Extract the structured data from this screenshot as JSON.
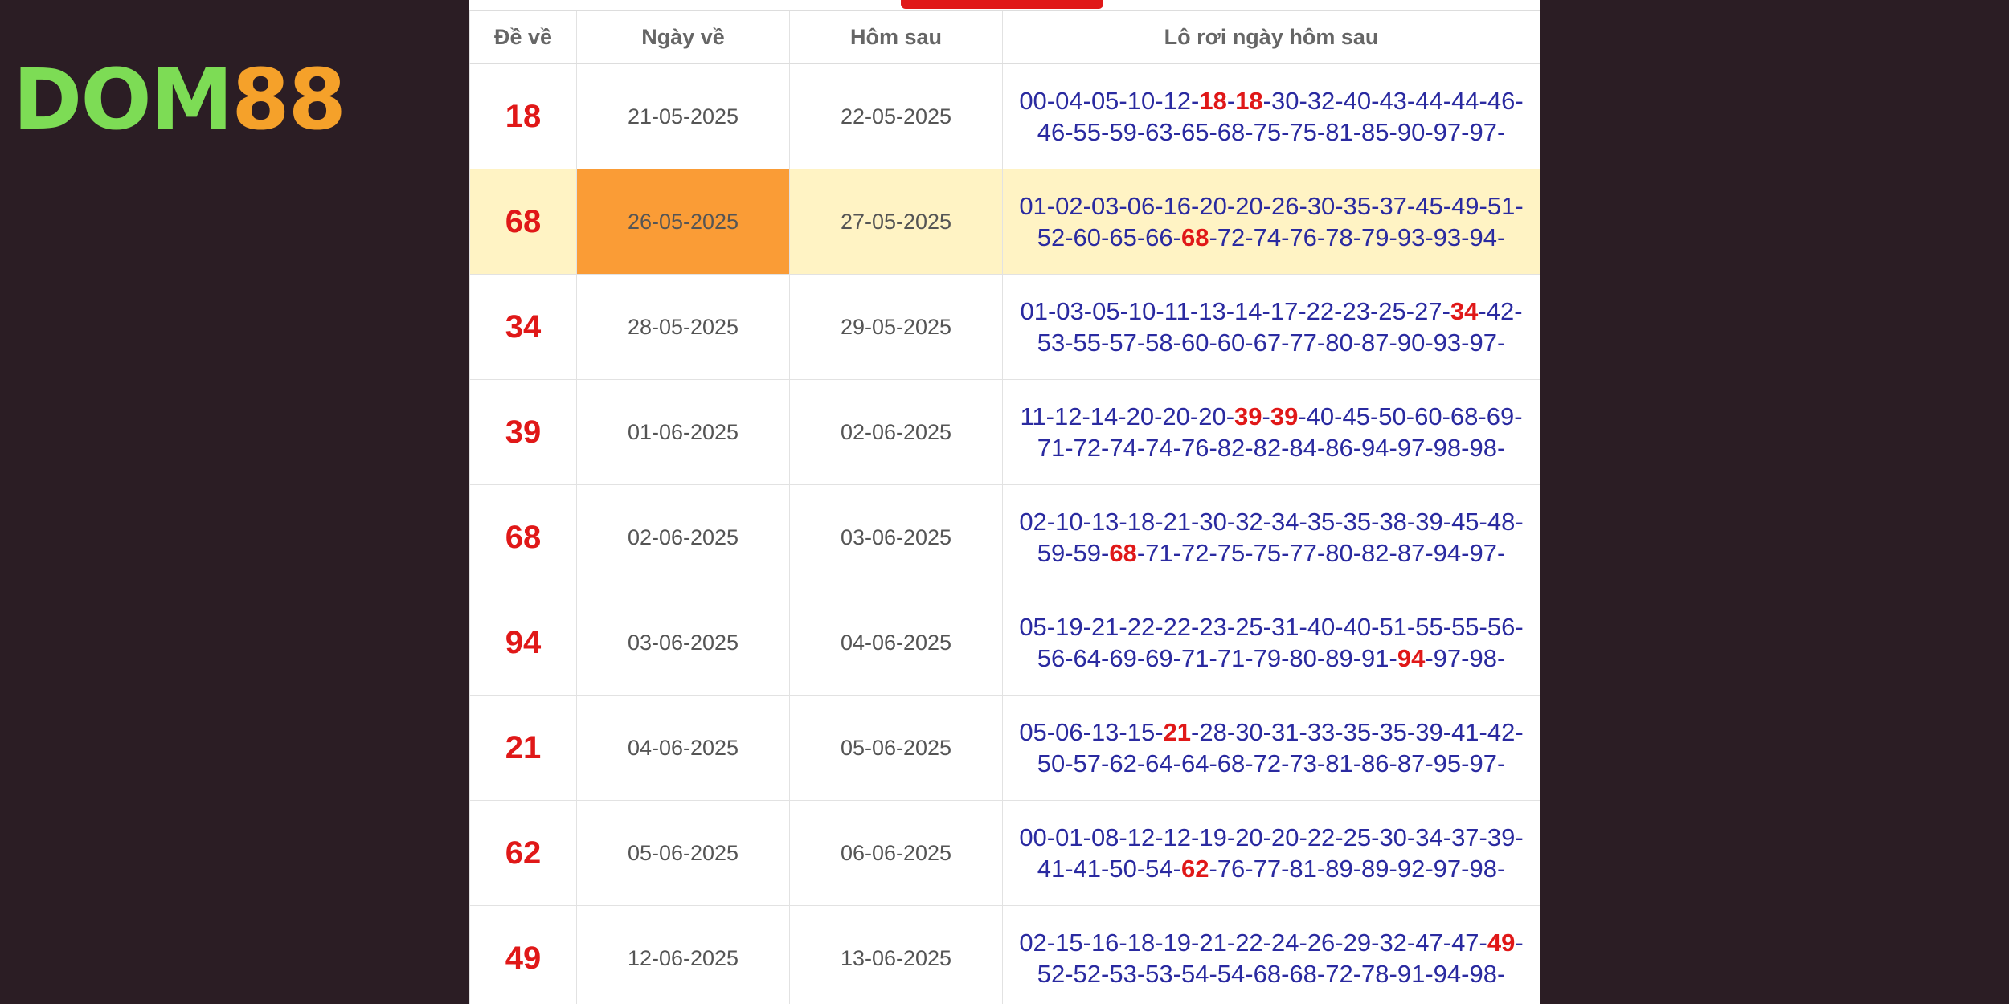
{
  "brand": {
    "part1": "DOM",
    "part2": "88"
  },
  "table": {
    "headers": [
      "Đề về",
      "Ngày về",
      "Hôm sau",
      "Lô rơi ngày hôm sau"
    ],
    "rows": [
      {
        "de": "18",
        "ngay_ve": "21-05-2025",
        "hom_sau": "22-05-2025",
        "lo": [
          "00",
          "04",
          "05",
          "10",
          "12",
          "18",
          "18",
          "30",
          "32",
          "40",
          "43",
          "44",
          "44",
          "46",
          "46",
          "55",
          "59",
          "63",
          "65",
          "68",
          "75",
          "75",
          "81",
          "85",
          "90",
          "97",
          "97"
        ]
      },
      {
        "de": "68",
        "ngay_ve": "26-05-2025",
        "hom_sau": "27-05-2025",
        "lo": [
          "01",
          "02",
          "03",
          "06",
          "16",
          "20",
          "20",
          "26",
          "30",
          "35",
          "37",
          "45",
          "49",
          "51",
          "52",
          "60",
          "65",
          "66",
          "68",
          "72",
          "74",
          "76",
          "78",
          "79",
          "93",
          "93",
          "94"
        ]
      },
      {
        "de": "34",
        "ngay_ve": "28-05-2025",
        "hom_sau": "29-05-2025",
        "lo": [
          "01",
          "03",
          "05",
          "10",
          "11",
          "13",
          "14",
          "17",
          "22",
          "23",
          "25",
          "27",
          "34",
          "42",
          "53",
          "55",
          "57",
          "58",
          "60",
          "60",
          "67",
          "77",
          "80",
          "87",
          "90",
          "93",
          "97"
        ]
      },
      {
        "de": "39",
        "ngay_ve": "01-06-2025",
        "hom_sau": "02-06-2025",
        "lo": [
          "11",
          "12",
          "14",
          "20",
          "20",
          "20",
          "39",
          "39",
          "40",
          "45",
          "50",
          "60",
          "68",
          "69",
          "71",
          "72",
          "74",
          "74",
          "76",
          "82",
          "82",
          "84",
          "86",
          "94",
          "97",
          "98",
          "98"
        ]
      },
      {
        "de": "68",
        "ngay_ve": "02-06-2025",
        "hom_sau": "03-06-2025",
        "lo": [
          "02",
          "10",
          "13",
          "18",
          "21",
          "30",
          "32",
          "34",
          "35",
          "35",
          "38",
          "39",
          "45",
          "48",
          "59",
          "59",
          "68",
          "71",
          "72",
          "75",
          "75",
          "77",
          "80",
          "82",
          "87",
          "94",
          "97"
        ]
      },
      {
        "de": "94",
        "ngay_ve": "03-06-2025",
        "hom_sau": "04-06-2025",
        "lo": [
          "05",
          "19",
          "21",
          "22",
          "22",
          "23",
          "25",
          "31",
          "40",
          "40",
          "51",
          "55",
          "55",
          "56",
          "56",
          "64",
          "69",
          "69",
          "71",
          "71",
          "79",
          "80",
          "89",
          "91",
          "94",
          "97",
          "98"
        ]
      },
      {
        "de": "21",
        "ngay_ve": "04-06-2025",
        "hom_sau": "05-06-2025",
        "lo": [
          "05",
          "06",
          "13",
          "15",
          "21",
          "28",
          "30",
          "31",
          "33",
          "35",
          "35",
          "39",
          "41",
          "42",
          "50",
          "57",
          "62",
          "64",
          "64",
          "68",
          "72",
          "73",
          "81",
          "86",
          "87",
          "95",
          "97"
        ]
      },
      {
        "de": "62",
        "ngay_ve": "05-06-2025",
        "hom_sau": "06-06-2025",
        "lo": [
          "00",
          "01",
          "08",
          "12",
          "12",
          "19",
          "20",
          "20",
          "22",
          "25",
          "30",
          "34",
          "37",
          "39",
          "41",
          "41",
          "50",
          "54",
          "62",
          "76",
          "77",
          "81",
          "89",
          "89",
          "92",
          "97",
          "98"
        ]
      },
      {
        "de": "49",
        "ngay_ve": "12-06-2025",
        "hom_sau": "13-06-2025",
        "lo": [
          "02",
          "15",
          "16",
          "18",
          "19",
          "21",
          "22",
          "24",
          "26",
          "29",
          "32",
          "47",
          "47",
          "49",
          "52",
          "52",
          "53",
          "53",
          "54",
          "54",
          "68",
          "68",
          "72",
          "78",
          "91",
          "94",
          "98"
        ]
      }
    ]
  },
  "colors": {
    "background": "#2b1d24",
    "accent_red": "#e01818",
    "lo_blue": "#2a2aa0",
    "highlight_row": "#fff3c4",
    "highlight_cell": "#fa9c36"
  }
}
